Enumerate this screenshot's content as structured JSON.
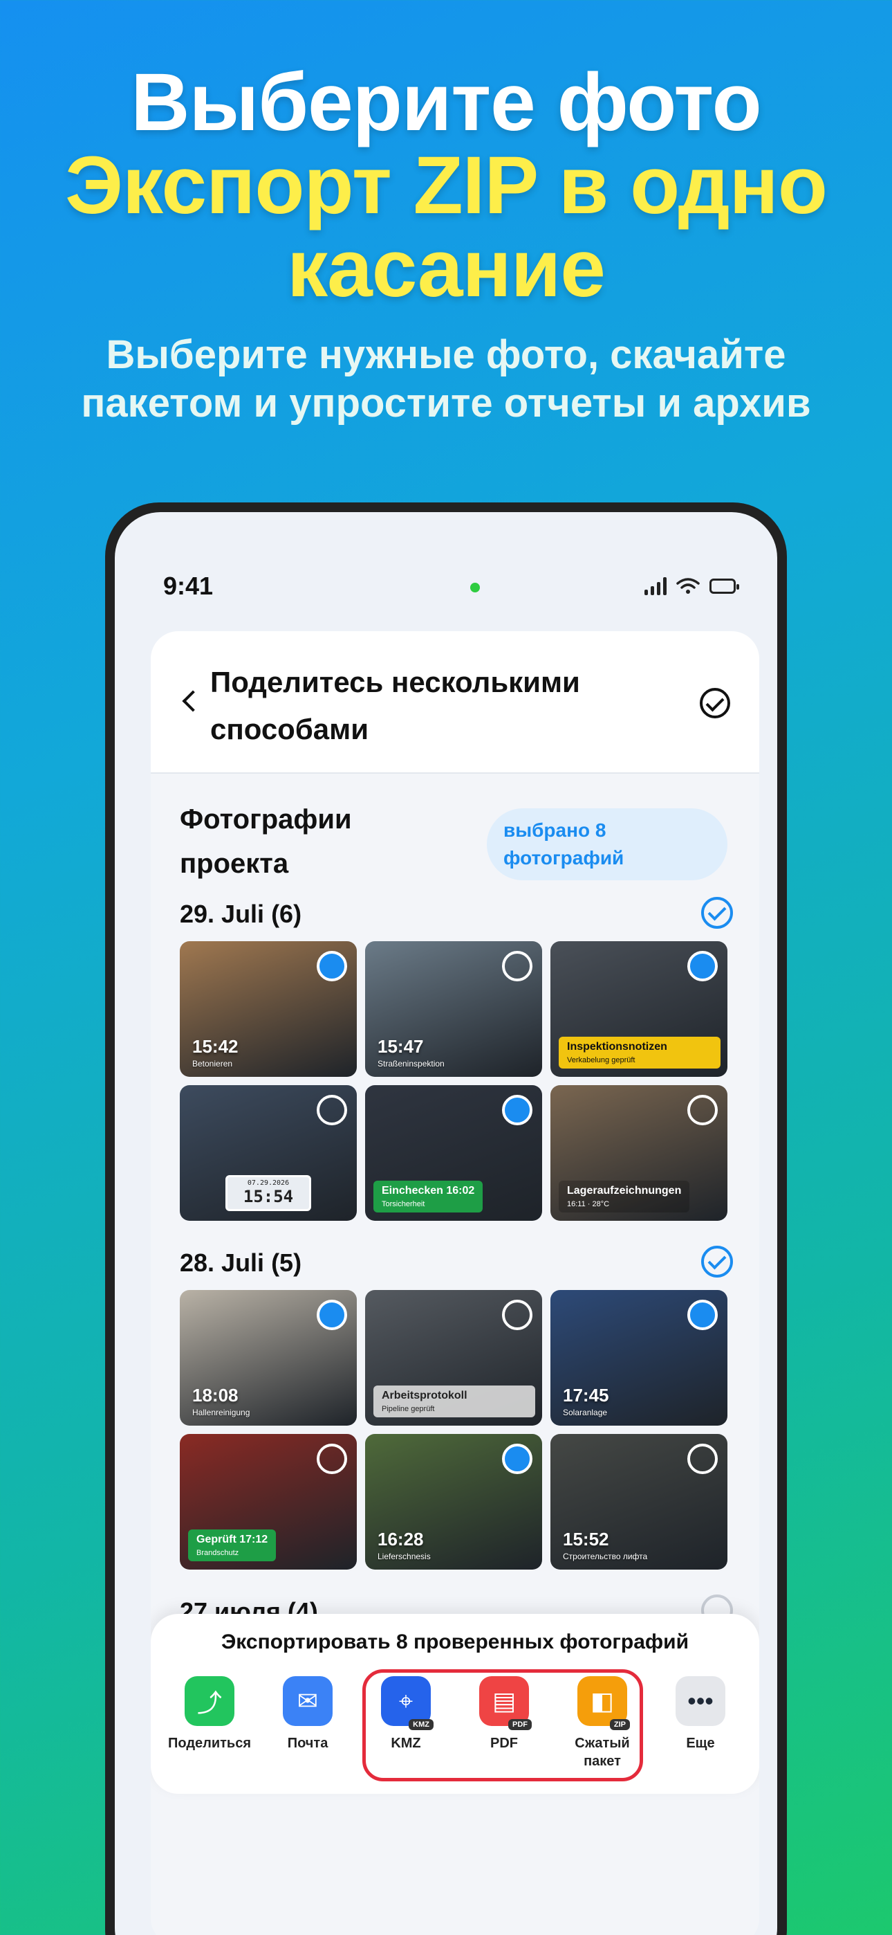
{
  "headline": {
    "line1": "Выберите фото",
    "line2": "Экспорт ZIP в одно",
    "line3": "касание"
  },
  "subhead": "Выберите нужные фото, скачайте пакетом и упростите отчеты и архив",
  "status": {
    "time": "9:41"
  },
  "card": {
    "title": "Поделитесь несколькими способами",
    "section_title": "Фотографии проекта",
    "selected_pill": "выбрано 8 фотографий"
  },
  "groups": [
    {
      "date": "29. Juli (6)",
      "checked": true,
      "photos": [
        {
          "time": "15:42",
          "sub": "Betonieren",
          "selected": true,
          "bg": "#a07850"
        },
        {
          "time": "15:47",
          "sub": "Straßeninspektion",
          "selected": false,
          "bg": "#6b7b88"
        },
        {
          "tag_title": "Inspektionsnotizen",
          "tag_sub": "Verkabelung geprüft",
          "selected": true,
          "bg": "#4a5058"
        },
        {
          "clock_date": "07.29.2026",
          "clock_time": "15:54",
          "selected": false,
          "bg": "#3d4b5e"
        },
        {
          "tag_title": "Einchecken 16:02",
          "tag_sub": "Torsicherheit",
          "selected": true,
          "bg": "#2f3540"
        },
        {
          "tag_title": "Lageraufzeichnungen",
          "tag_sub": "16:11 · 28°C",
          "selected": false,
          "bg": "#7a6650"
        }
      ]
    },
    {
      "date": "28. Juli (5)",
      "checked": true,
      "photos": [
        {
          "time": "18:08",
          "sub": "Hallenreinigung",
          "selected": true,
          "bg": "#b9b2a6"
        },
        {
          "tag_title": "Arbeitsprotokoll",
          "tag_sub": "Pipeline geprüft",
          "selected": false,
          "bg": "#555a60"
        },
        {
          "time": "17:45",
          "sub": "Solaranlage",
          "selected": true,
          "bg": "#2d4a78"
        },
        {
          "tag_title": "Geprüft 17:12",
          "tag_sub": "Brandschutz",
          "selected": false,
          "bg": "#8a2a24"
        },
        {
          "time": "16:28",
          "sub": "Lieferschnesis",
          "selected": true,
          "bg": "#4f6a3a"
        },
        {
          "time": "15:52",
          "sub": "Строительство лифта",
          "selected": false,
          "bg": "#454845"
        }
      ]
    },
    {
      "date": "27 июля (4)",
      "checked": false
    }
  ],
  "sheet": {
    "title": "Экспортировать 8 проверенных фотографий",
    "actions": [
      {
        "label": "Поделиться",
        "icon": "share-icon",
        "color": "#22c55e"
      },
      {
        "label": "Почта",
        "icon": "mail-icon",
        "color": "#3b82f6"
      },
      {
        "label": "KMZ",
        "icon": "map-icon",
        "color": "#2563eb",
        "badge": "KMZ"
      },
      {
        "label": "PDF",
        "icon": "pdf-icon",
        "color": "#ef4444",
        "badge": "PDF"
      },
      {
        "label": "Сжатый пакет",
        "icon": "zip-icon",
        "color": "#f59e0b",
        "badge": "ZIP"
      },
      {
        "label": "Еще",
        "icon": "more-icon",
        "color": "#e5e7eb"
      }
    ]
  }
}
